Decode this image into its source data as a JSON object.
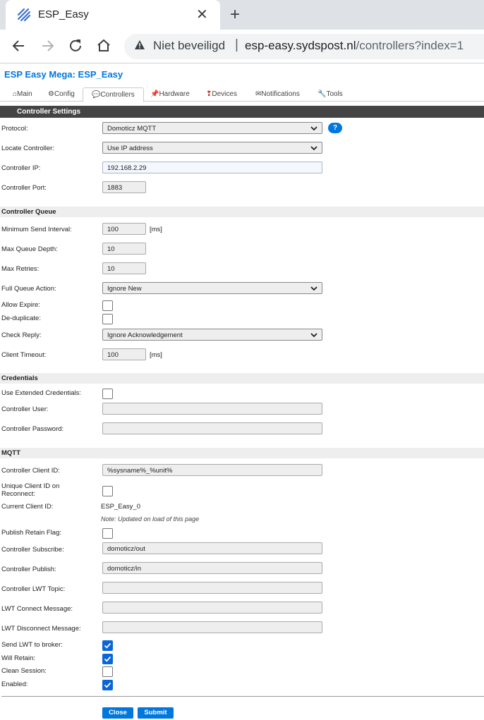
{
  "browser": {
    "tab_title": "ESP_Easy",
    "tab_close": "✕",
    "new_tab": "+",
    "not_secure": "Niet beveiligd",
    "separator": "|",
    "url_host": "esp-easy.sydspost.nl",
    "url_path": "/controllers?index=1"
  },
  "page": {
    "title": "ESP Easy Mega: ESP_Easy"
  },
  "menu": {
    "items": [
      {
        "label": "⌂Main"
      },
      {
        "label": "⚙Config"
      },
      {
        "label": "💬Controllers"
      },
      {
        "label": "📌Hardware"
      },
      {
        "label": "Devices",
        "icon": "pin-icon"
      },
      {
        "label": "✉Notifications"
      },
      {
        "label": "🔧Tools"
      }
    ],
    "active_index": 2
  },
  "controller": {
    "header": "Controller Settings",
    "protocol_label": "Protocol:",
    "protocol_value": "Domoticz MQTT",
    "help": "?",
    "locate_label": "Locate Controller:",
    "locate_value": "Use IP address",
    "ip_label": "Controller IP:",
    "ip_value": "192.168.2.29",
    "port_label": "Controller Port:",
    "port_value": "1883"
  },
  "queue": {
    "header": "Controller Queue",
    "min_send_label": "Minimum Send Interval:",
    "min_send_value": "100",
    "min_send_unit": "[ms]",
    "max_depth_label": "Max Queue Depth:",
    "max_depth_value": "10",
    "max_retries_label": "Max Retries:",
    "max_retries_value": "10",
    "full_action_label": "Full Queue Action:",
    "full_action_value": "Ignore New",
    "allow_expire_label": "Allow Expire:",
    "allow_expire_checked": false,
    "dedup_label": "De-duplicate:",
    "dedup_checked": false,
    "check_reply_label": "Check Reply:",
    "check_reply_value": "Ignore Acknowledgement",
    "timeout_label": "Client Timeout:",
    "timeout_value": "100",
    "timeout_unit": "[ms]"
  },
  "credentials": {
    "header": "Credentials",
    "extended_label": "Use Extended Credentials:",
    "extended_checked": false,
    "user_label": "Controller User:",
    "user_value": "",
    "password_label": "Controller Password:",
    "password_value": ""
  },
  "mqtt": {
    "header": "MQTT",
    "client_id_label": "Controller Client ID:",
    "client_id_value": "%sysname%_%unit%",
    "unique_label_1": "Unique Client ID on",
    "unique_label_2": "Reconnect:",
    "unique_checked": false,
    "current_id_label": "Current Client ID:",
    "current_id_value": "ESP_Easy_0",
    "current_id_note": "Note: Updated on load of this page",
    "retain_label": "Publish Retain Flag:",
    "retain_checked": false,
    "subscribe_label": "Controller Subscribe:",
    "subscribe_value": "domoticz/out",
    "publish_label": "Controller Publish:",
    "publish_value": "domoticz/in",
    "lwt_topic_label": "Controller LWT Topic:",
    "lwt_topic_value": "",
    "lwt_connect_label": "LWT Connect Message:",
    "lwt_connect_value": "",
    "lwt_disconnect_label": "LWT Disconnect Message:",
    "lwt_disconnect_value": "",
    "send_lwt_label": "Send LWT to broker:",
    "send_lwt_checked": true,
    "will_retain_label": "Will Retain:",
    "will_retain_checked": true,
    "clean_session_label": "Clean Session:",
    "clean_session_checked": false,
    "enabled_label": "Enabled:",
    "enabled_checked": true
  },
  "buttons": {
    "close": "Close",
    "submit": "Submit"
  },
  "colors": {
    "accent": "#0077dd",
    "header_bar": "#444444",
    "checkbox_checked": "#0a66d8"
  }
}
